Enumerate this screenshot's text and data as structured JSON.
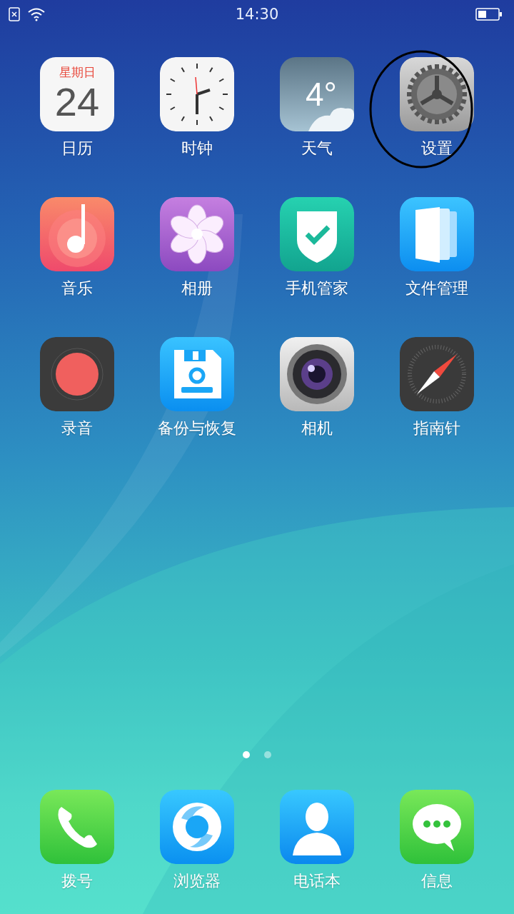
{
  "status_bar": {
    "time": "14:30"
  },
  "apps": [
    {
      "kind": "calendar",
      "label": "日历",
      "weekday": "星期日",
      "day": "24",
      "highlighted": false
    },
    {
      "kind": "clock",
      "label": "时钟",
      "highlighted": false
    },
    {
      "kind": "weather",
      "label": "天气",
      "temperature": "4°",
      "highlighted": false
    },
    {
      "kind": "settings",
      "label": "设置",
      "highlighted": true
    },
    {
      "kind": "music",
      "label": "音乐",
      "highlighted": false
    },
    {
      "kind": "photos",
      "label": "相册",
      "highlighted": false
    },
    {
      "kind": "security",
      "label": "手机管家",
      "highlighted": false
    },
    {
      "kind": "files",
      "label": "文件管理",
      "highlighted": false
    },
    {
      "kind": "recorder",
      "label": "录音",
      "highlighted": false
    },
    {
      "kind": "backup",
      "label": "备份与恢复",
      "highlighted": false
    },
    {
      "kind": "camera",
      "label": "相机",
      "highlighted": false
    },
    {
      "kind": "compass",
      "label": "指南针",
      "highlighted": false
    }
  ],
  "page_indicator": [
    {
      "selected": true
    },
    {
      "selected": false
    }
  ],
  "dock": [
    {
      "kind": "phone",
      "label": "拨号"
    },
    {
      "kind": "browser",
      "label": "浏览器"
    },
    {
      "kind": "contacts",
      "label": "电话本"
    },
    {
      "kind": "messages",
      "label": "信息"
    }
  ]
}
